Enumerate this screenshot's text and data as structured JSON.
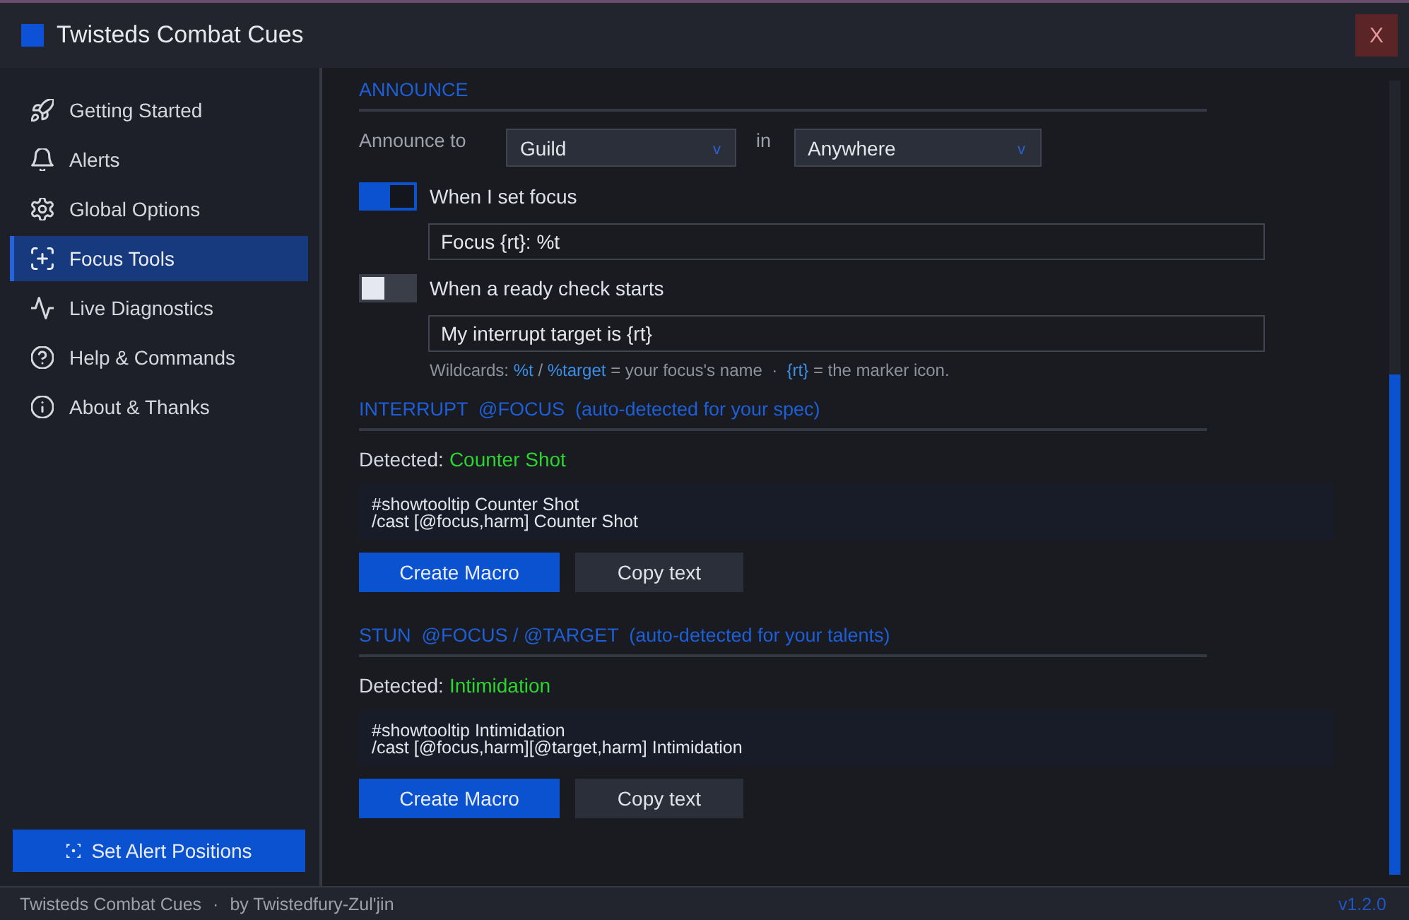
{
  "window": {
    "title": "Twisteds Combat Cues",
    "close_label": "X"
  },
  "sidebar": {
    "items": [
      {
        "label": "Getting Started",
        "selected": false
      },
      {
        "label": "Alerts",
        "selected": false
      },
      {
        "label": "Global Options",
        "selected": false
      },
      {
        "label": "Focus Tools",
        "selected": true
      },
      {
        "label": "Live Diagnostics",
        "selected": false
      },
      {
        "label": "Help & Commands",
        "selected": false
      },
      {
        "label": "About & Thanks",
        "selected": false
      }
    ],
    "action_button": "Set Alert Positions"
  },
  "announce": {
    "heading": "ANNOUNCE",
    "label": "Announce to",
    "channel": {
      "value": "Guild",
      "caret": "v"
    },
    "connector": "in",
    "location": {
      "value": "Anywhere",
      "caret": "v"
    },
    "triggers": [
      {
        "label": "When I set focus",
        "on": true,
        "message": "Focus {rt}: %t"
      },
      {
        "label": "When a ready check starts",
        "on": false,
        "message": "My interrupt target is {rt}"
      }
    ],
    "hint": [
      {
        "kind": "text",
        "text": "Wildcards: "
      },
      {
        "kind": "code",
        "text": "%t"
      },
      {
        "kind": "text",
        "text": " / "
      },
      {
        "kind": "code",
        "text": "%target"
      },
      {
        "kind": "text",
        "text": " = your focus's name  ·  "
      },
      {
        "kind": "code",
        "text": "{rt}"
      },
      {
        "kind": "text",
        "text": " = the marker icon."
      }
    ]
  },
  "sections": [
    {
      "heading": "INTERRUPT  @FOCUS  (auto-detected for your spec)",
      "detected_label": "Detected:",
      "detected_value": "Counter Shot",
      "macro": [
        "#showtooltip Counter Shot",
        "/cast [@focus,harm] Counter Shot"
      ],
      "buttons": [
        {
          "label": "Create Macro",
          "kind": "primary"
        },
        {
          "label": "Copy text",
          "kind": "secondary"
        }
      ]
    },
    {
      "heading": "STUN  @FOCUS / @TARGET  (auto-detected for your talents)",
      "detected_label": "Detected:",
      "detected_value": "Intimidation",
      "macro": [
        "#showtooltip Intimidation",
        "/cast [@focus,harm][@target,harm] Intimidation"
      ],
      "buttons": [
        {
          "label": "Create Macro",
          "kind": "primary"
        },
        {
          "label": "Copy text",
          "kind": "secondary"
        }
      ]
    }
  ],
  "status_bar": {
    "app_name": "Twisteds Combat Cues",
    "separator": "·",
    "author": "by Twistedfury-Zul'jin",
    "version": "v1.2.0"
  }
}
